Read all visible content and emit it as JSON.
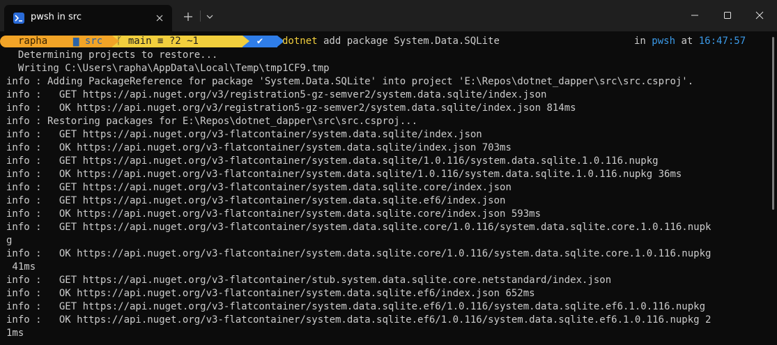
{
  "window": {
    "tab_title": "pwsh in src"
  },
  "prompt": {
    "user": "rapha",
    "dir": "src",
    "git": "main ≡ ?2 ~1",
    "status_glyph": "✔",
    "command_exe": "dotnet",
    "command_args": " add package System.Data.SQLite",
    "right_in": "in ",
    "shell": "pwsh",
    "right_at": " at ",
    "time": "16:47:57"
  },
  "output": [
    "  Determining projects to restore...",
    "  Writing C:\\Users\\rapha\\AppData\\Local\\Temp\\tmp1CF9.tmp",
    "info : Adding PackageReference for package 'System.Data.SQLite' into project 'E:\\Repos\\dotnet_dapper\\src\\src.csproj'.",
    "info :   GET https://api.nuget.org/v3/registration5-gz-semver2/system.data.sqlite/index.json",
    "info :   OK https://api.nuget.org/v3/registration5-gz-semver2/system.data.sqlite/index.json 814ms",
    "info : Restoring packages for E:\\Repos\\dotnet_dapper\\src\\src.csproj...",
    "info :   GET https://api.nuget.org/v3-flatcontainer/system.data.sqlite/index.json",
    "info :   OK https://api.nuget.org/v3-flatcontainer/system.data.sqlite/index.json 703ms",
    "info :   GET https://api.nuget.org/v3-flatcontainer/system.data.sqlite/1.0.116/system.data.sqlite.1.0.116.nupkg",
    "info :   OK https://api.nuget.org/v3-flatcontainer/system.data.sqlite/1.0.116/system.data.sqlite.1.0.116.nupkg 36ms",
    "info :   GET https://api.nuget.org/v3-flatcontainer/system.data.sqlite.core/index.json",
    "info :   GET https://api.nuget.org/v3-flatcontainer/system.data.sqlite.ef6/index.json",
    "info :   OK https://api.nuget.org/v3-flatcontainer/system.data.sqlite.core/index.json 593ms",
    "info :   GET https://api.nuget.org/v3-flatcontainer/system.data.sqlite.core/1.0.116/system.data.sqlite.core.1.0.116.nupk",
    "g",
    "info :   OK https://api.nuget.org/v3-flatcontainer/system.data.sqlite.core/1.0.116/system.data.sqlite.core.1.0.116.nupkg",
    " 41ms",
    "info :   GET https://api.nuget.org/v3-flatcontainer/stub.system.data.sqlite.core.netstandard/index.json",
    "info :   OK https://api.nuget.org/v3-flatcontainer/system.data.sqlite.ef6/index.json 652ms",
    "info :   GET https://api.nuget.org/v3-flatcontainer/system.data.sqlite.ef6/1.0.116/system.data.sqlite.ef6.1.0.116.nupkg",
    "info :   OK https://api.nuget.org/v3-flatcontainer/system.data.sqlite.ef6/1.0.116/system.data.sqlite.ef6.1.0.116.nupkg 2",
    "1ms"
  ],
  "colors": {
    "background": "#0c0c0c",
    "titlebar": "#1f1f1f",
    "prompt_orange": "#f2a427",
    "prompt_yellow": "#f2cf3d",
    "prompt_blue": "#2f7de8",
    "accent_blue": "#3b9ae8"
  },
  "icons": {
    "tab": "powershell-icon",
    "close_tab": "close-icon",
    "new_tab": "plus-icon",
    "dropdown": "chevron-down-icon",
    "minimize": "minimize-icon",
    "maximize": "maximize-icon",
    "close_window": "close-icon"
  }
}
